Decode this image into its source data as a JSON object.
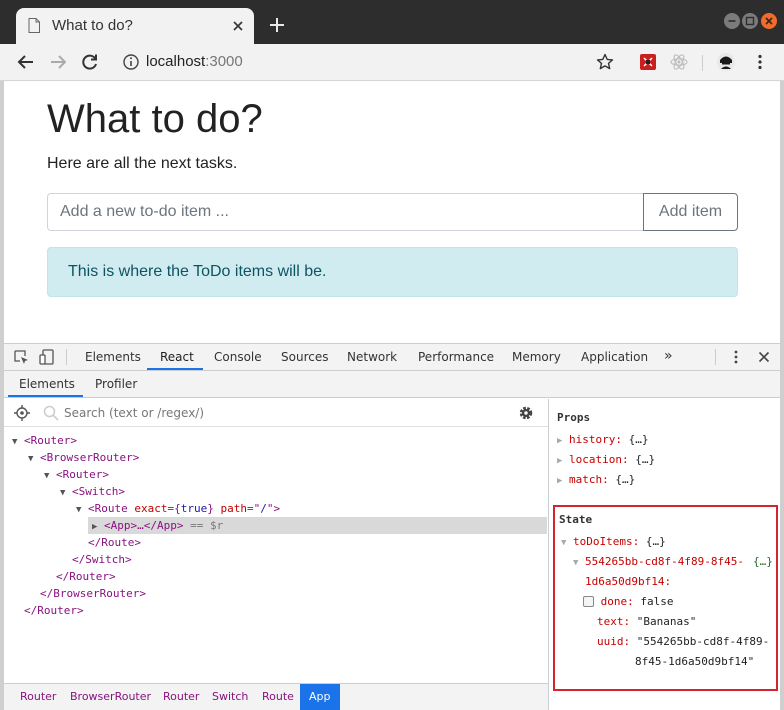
{
  "browser": {
    "tab_title": "What to do?",
    "url_host": "localhost",
    "url_port": ":3000"
  },
  "page": {
    "title": "What to do?",
    "subtitle": "Here are all the next tasks.",
    "input_placeholder": "Add a new to-do item ...",
    "add_button": "Add item",
    "alert_text": "This is where the ToDo items will be."
  },
  "devtools": {
    "tabs": [
      "Elements",
      "React",
      "Console",
      "Sources",
      "Network",
      "Performance",
      "Memory",
      "Application"
    ],
    "active_tab": "React",
    "more_tabs": "»",
    "sub_tabs": [
      "Elements",
      "Profiler"
    ],
    "active_sub_tab": "Elements",
    "search_placeholder": "Search (text or /regex/)",
    "tree": [
      {
        "open": "<",
        "name": "Router",
        "close": ">"
      },
      {
        "open": "<",
        "name": "BrowserRouter",
        "close": ">"
      },
      {
        "open": "<",
        "name": "Router",
        "close": ">"
      },
      {
        "open": "<",
        "name": "Switch",
        "close": ">"
      },
      {
        "open": "<",
        "name": "Route",
        "attr1": "exact",
        "eq1": "={",
        "val1": "true",
        "end1": "}",
        "attr2": "path",
        "eq2": "=\"",
        "val2": "/",
        "end2": "\"",
        "close": ">"
      },
      {
        "open": "<",
        "name": "App",
        "mid": ">…</",
        "name2": "App",
        "close": ">",
        "suffix": " == $r"
      },
      {
        "open": "</",
        "name": "Route",
        "close": ">"
      },
      {
        "open": "</",
        "name": "Switch",
        "close": ">"
      },
      {
        "open": "</",
        "name": "Router",
        "close": ">"
      },
      {
        "open": "</",
        "name": "BrowserRouter",
        "close": ">"
      },
      {
        "open": "</",
        "name": "Router",
        "close": ">"
      }
    ],
    "breadcrumbs": [
      "Router",
      "BrowserRouter",
      "Router",
      "Switch",
      "Route",
      "App"
    ],
    "active_breadcrumb": "App",
    "props_header": "Props",
    "props": [
      {
        "key": "history:",
        "value": "{…}"
      },
      {
        "key": "location:",
        "value": "{…}"
      },
      {
        "key": "match:",
        "value": "{…}"
      }
    ],
    "state_header": "State",
    "state": {
      "todo_key": "toDoItems:",
      "todo_value": "{…}",
      "item_key_line1": "554265bb-cd8f-4f89-8f45-",
      "item_key_line2": "1d6a50d9bf14:",
      "item_value": "{…}",
      "done_key": "done:",
      "done_value": "false",
      "text_key": "text:",
      "text_value": "\"Bananas\"",
      "uuid_key": "uuid:",
      "uuid_value_line1": "\"554265bb-cd8f-4f89-",
      "uuid_value_line2": "8f45-1d6a50d9bf14\""
    }
  },
  "colors": {
    "tabbar_bg": "#2d2d2d",
    "alert_bg": "#d1ecf1",
    "alert_text": "#0c5460",
    "react_tag": "#881280",
    "prop_key": "#c80000",
    "highlight_box": "#d1262f",
    "active_accent": "#1a73e8"
  }
}
